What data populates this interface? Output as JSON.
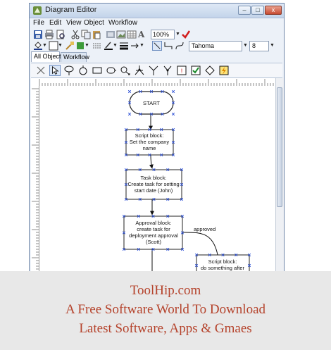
{
  "window": {
    "title": "Diagram Editor",
    "controls": {
      "minimize": "–",
      "maximize": "□",
      "close": "x"
    }
  },
  "menu": {
    "items": [
      "File",
      "Edit",
      "View",
      "Object",
      "Workflow"
    ]
  },
  "toolbar": {
    "zoom_value": "100%",
    "font_name": "Tahoma",
    "font_size": "8",
    "text_tool_glyph": "A"
  },
  "tabs": [
    {
      "label": "All Objects",
      "active": true
    },
    {
      "label": "Workflow",
      "active": false
    }
  ],
  "shape_tools": [
    "close-icon",
    "pointer-icon",
    "connector-icon",
    "rounded-rect-icon",
    "rect-icon",
    "ellipse-icon",
    "cloud-icon",
    "split-icon",
    "merge-icon",
    "fork-icon",
    "approval-icon",
    "checkbox-icon",
    "diamond-icon",
    "script-icon"
  ],
  "diagram": {
    "start": {
      "label": "START"
    },
    "blocks": [
      {
        "id": "script1",
        "lines": [
          "Script block:",
          "Set the company",
          "name"
        ]
      },
      {
        "id": "task1",
        "lines": [
          "Task block:",
          "Create task for setting",
          "start date (John)"
        ]
      },
      {
        "id": "approval1",
        "lines": [
          "Approval block:",
          "create task for",
          "deployment approval",
          "(Scott)"
        ]
      },
      {
        "id": "script2",
        "lines": [
          "Script block:",
          "do something after"
        ]
      }
    ],
    "edge_labels": {
      "approved": "approved"
    }
  },
  "footer": {
    "line1": "ToolHip.com",
    "line2": "A Free Software World To Download",
    "line3": "Latest Software, Apps & Gmaes"
  },
  "colors": {
    "footer_text": "#b5432c",
    "footer_bg": "#e8e8e8",
    "block_border": "#333333",
    "handle": "#2b4fd6",
    "start_fill": "#ffffff"
  }
}
